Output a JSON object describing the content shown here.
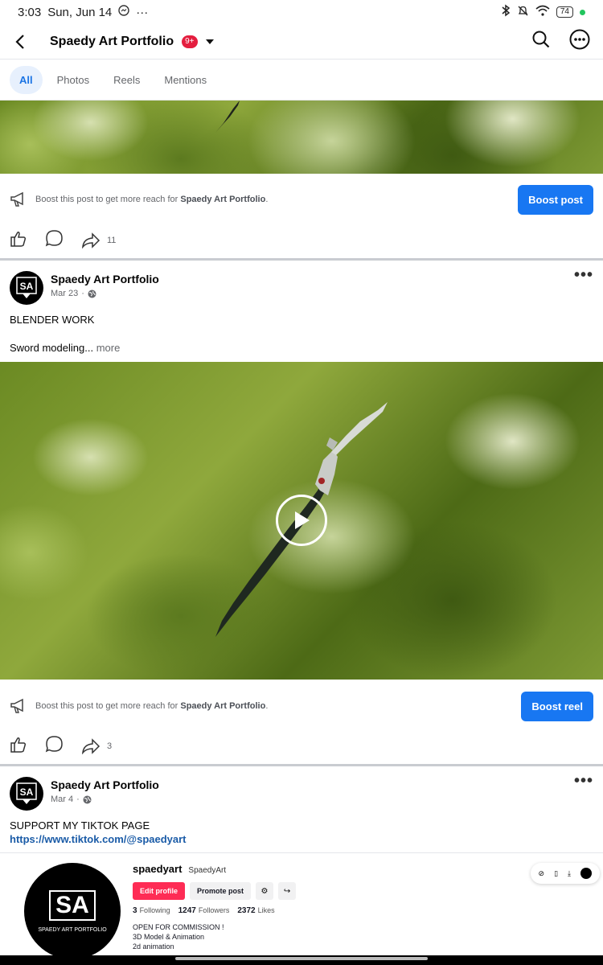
{
  "status_bar": {
    "time": "3:03",
    "date": "Sun, Jun 14",
    "battery": "74"
  },
  "header": {
    "title": "Spaedy Art Portfolio",
    "badge": "9+"
  },
  "tabs": [
    {
      "label": "All",
      "active": true
    },
    {
      "label": "Photos"
    },
    {
      "label": "Reels"
    },
    {
      "label": "Mentions"
    }
  ],
  "post1": {
    "boost_text": "Boost this post to get more reach for",
    "boost_page": "Spaedy Art Portfolio",
    "boost_button": "Boost post",
    "share_count": "11"
  },
  "post2": {
    "author": "Spaedy Art Portfolio",
    "date": "Mar 23",
    "line1": "BLENDER WORK",
    "line2": "Sword modeling...",
    "more": "more",
    "boost_text": "Boost this post to get more reach for",
    "boost_page": "Spaedy Art Portfolio",
    "boost_button": "Boost reel",
    "share_count": "3"
  },
  "post3": {
    "author": "Spaedy Art Portfolio",
    "date": "Mar 4",
    "line1": "SUPPORT MY TIKTOK PAGE",
    "link": "https://www.tiktok.com/@spaedyart"
  },
  "tiktok_preview": {
    "username": "spaedyart",
    "display_name": "SpaedyArt",
    "edit_button": "Edit profile",
    "promote_button": "Promote post",
    "following_count": "3",
    "following_label": "Following",
    "followers_count": "1247",
    "followers_label": "Followers",
    "likes_count": "2372",
    "likes_label": "Likes",
    "bio": [
      "OPEN FOR COMMISSION !",
      "3D Model & Animation",
      "2d animation"
    ],
    "logo_text": "SA",
    "logo_sub": "SPAEDY ART PORTFOLIO"
  },
  "avatar_logo": "SA",
  "colors": {
    "accent": "#1877f2",
    "badge": "#e41e3f",
    "tiktok_pink": "#fe2c55"
  },
  "icons": [
    "back-arrow-icon",
    "search-icon",
    "more-options-icon",
    "megaphone-icon",
    "like-icon",
    "comment-icon",
    "share-icon",
    "globe-icon",
    "play-icon"
  ]
}
